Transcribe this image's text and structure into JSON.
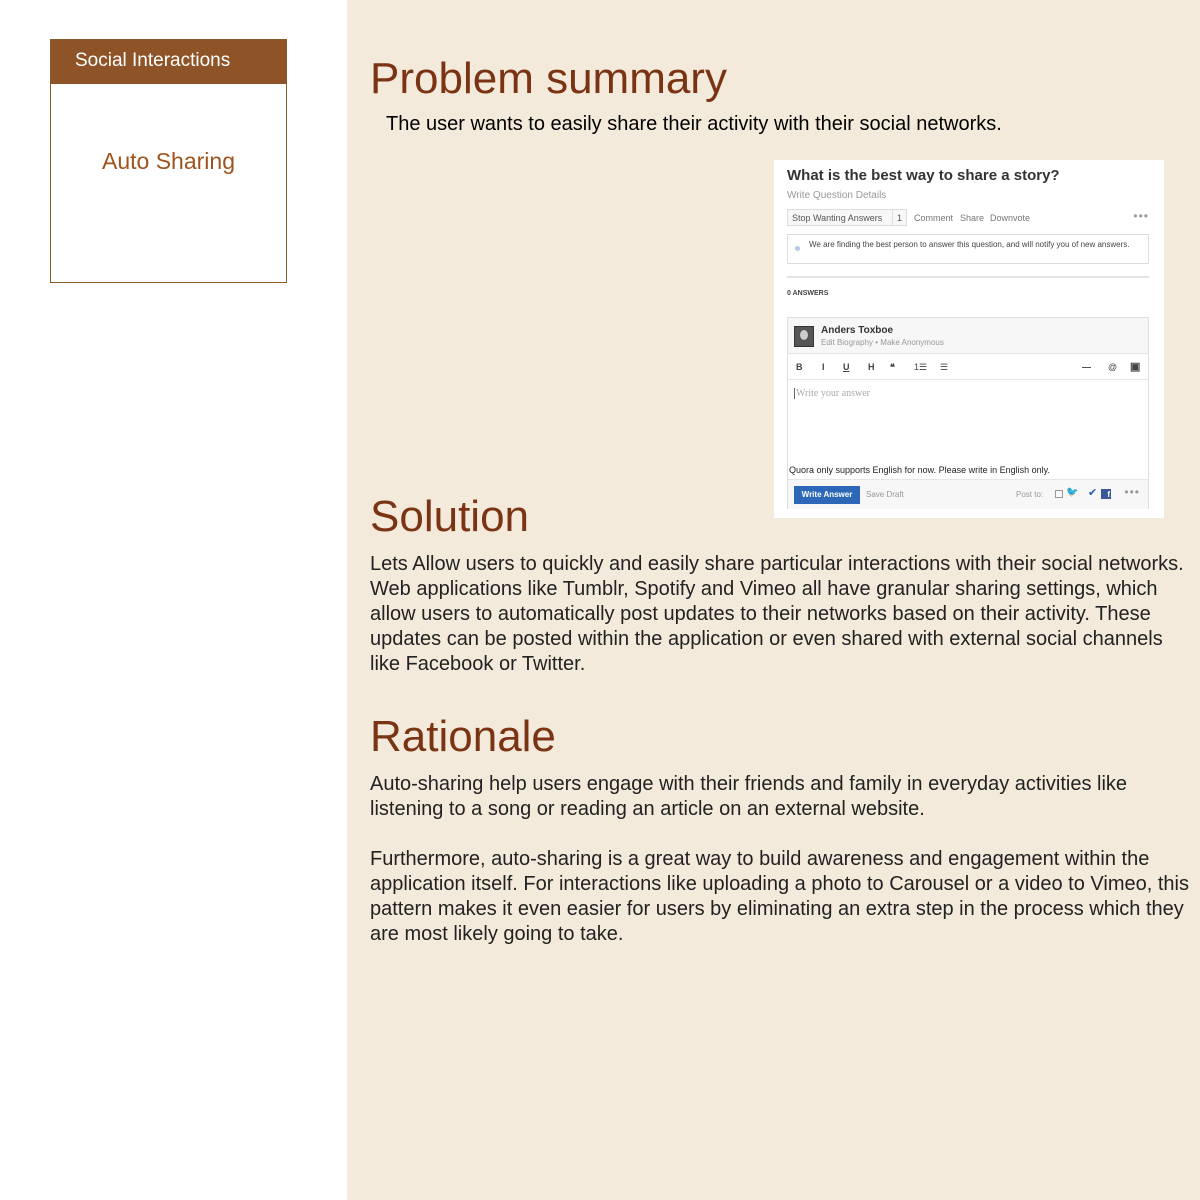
{
  "sidebar": {
    "card_title": "Social Interactions",
    "card_item": "Auto Sharing"
  },
  "problem": {
    "heading": "Problem summary",
    "text": "The user wants to easily share their activity with their social networks."
  },
  "solution": {
    "heading": "Solution",
    "text": "Lets Allow users to quickly and easily share particular interactions with their social networks. Web applications like Tumblr, Spotify and Vimeo all have granular sharing settings, which allow users to automatically post updates to their networks based on their activity. These updates can be posted within the application or even shared with external social channels like Facebook or Twitter."
  },
  "rationale": {
    "heading": "Rationale",
    "paragraph1": "Auto-sharing help users engage with their friends and family in everyday activities like listening to a song or reading an article on an external website.",
    "paragraph2": "Furthermore, auto-sharing is a great way to build awareness and engagement within the application itself. For interactions like uploading a photo to Carousel or a video to Vimeo, this pattern makes it even easier for users by eliminating an extra step in the process which they are most likely going to take."
  },
  "screenshot": {
    "question_title": "What is the best way to share a story?",
    "question_details": "Write Question Details",
    "stop_wanting": "Stop Wanting Answers",
    "stop_count": "1",
    "comment": "Comment",
    "share": "Share",
    "downvote": "Downvote",
    "more": "•••",
    "notice": "We are finding the best person to answer this question, and will notify you of new answers.",
    "answers_count": "0 ANSWERS",
    "author_name": "Anders Toxboe",
    "author_links": "Edit Biography • Make Anonymous",
    "toolbar": {
      "bold": "B",
      "italic": "I",
      "underline": "U",
      "heading": "H",
      "quote": "❝",
      "ordered_list": "1☰",
      "bullet_list": "☰",
      "rule": "—",
      "mention": "@",
      "image": "▣"
    },
    "placeholder": "Write your answer",
    "language_note": "Quora only supports English for now. Please write in English only.",
    "write_answer": "Write Answer",
    "save_draft": "Save Draft",
    "post_to": "Post to:",
    "twitter_glyph": "🐦",
    "facebook_glyph": "f",
    "checked_glyph": "✔",
    "foot_more": "•••"
  },
  "colors": {
    "accent_brown": "#8e5428",
    "heading_brown": "#7a3414",
    "panel_bg": "#f4eadb",
    "quora_blue": "#2d68b8"
  }
}
